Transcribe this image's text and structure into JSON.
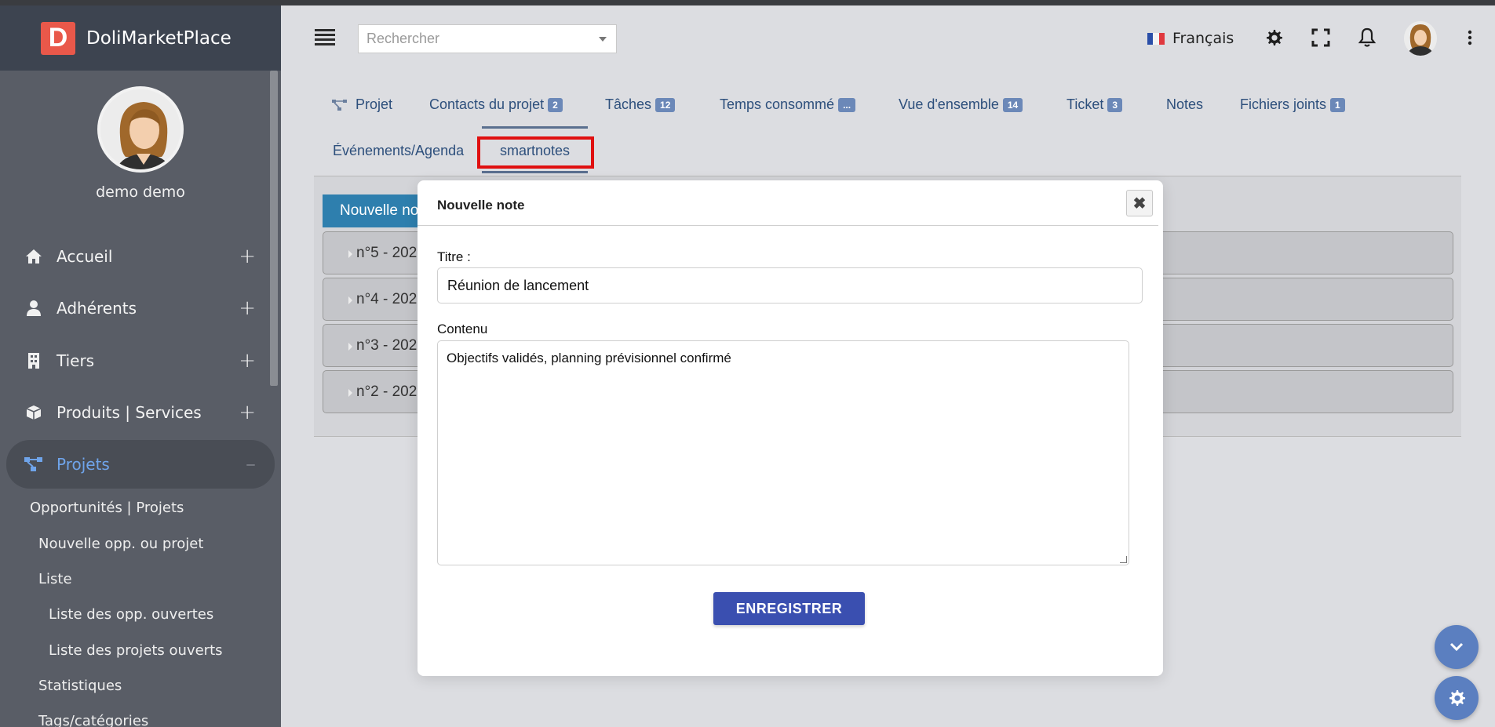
{
  "app": {
    "name": "DoliMarketPlace",
    "logo_letter": "D"
  },
  "user": {
    "name": "demo demo"
  },
  "sidebar": {
    "items": [
      {
        "label": "Accueil",
        "icon": "home-icon",
        "toggle": "+"
      },
      {
        "label": "Adhérents",
        "icon": "user-icon",
        "toggle": "+"
      },
      {
        "label": "Tiers",
        "icon": "building-icon",
        "toggle": "+"
      },
      {
        "label": "Produits | Services",
        "icon": "box-icon",
        "toggle": "+"
      },
      {
        "label": "Projets",
        "icon": "project-icon",
        "toggle": "–"
      }
    ],
    "subitems": [
      "Opportunités | Projets",
      "Nouvelle opp. ou projet",
      "Liste",
      "Liste des opp. ouvertes",
      "Liste des projets ouverts",
      "Statistiques",
      "Tags/catégories"
    ]
  },
  "topbar": {
    "search_placeholder": "Rechercher",
    "language": "Français"
  },
  "tabs": [
    {
      "label": "Projet",
      "badge": null
    },
    {
      "label": "Contacts du projet",
      "badge": "2"
    },
    {
      "label": "Tâches",
      "badge": "12"
    },
    {
      "label": "Temps consommé",
      "badge": "..."
    },
    {
      "label": "Vue d'ensemble",
      "badge": "14"
    },
    {
      "label": "Ticket",
      "badge": "3"
    },
    {
      "label": "Notes",
      "badge": null
    },
    {
      "label": "Fichiers joints",
      "badge": "1"
    },
    {
      "label": "Événements/Agenda",
      "badge": null
    },
    {
      "label": "smartnotes",
      "badge": null
    }
  ],
  "notes_panel": {
    "new_note_button": "Nouvelle note",
    "rows": [
      "n°5 - 202",
      "n°4 - 202",
      "n°3 - 202",
      "n°2 - 202"
    ]
  },
  "modal": {
    "title": "Nouvelle note",
    "close_symbol": "✖",
    "title_label": "Titre :",
    "title_value": "Réunion de lancement",
    "content_label": "Contenu",
    "content_value": "Objectifs validés, planning prévisionnel confirmé",
    "save_label": "ENREGISTRER"
  },
  "colors": {
    "sidebar_bg": "#595d66",
    "brand_bg": "#3d4450",
    "accent_blue": "#3a4fb0",
    "tab_text": "#2d4f7c",
    "highlight_red": "#e01010"
  }
}
